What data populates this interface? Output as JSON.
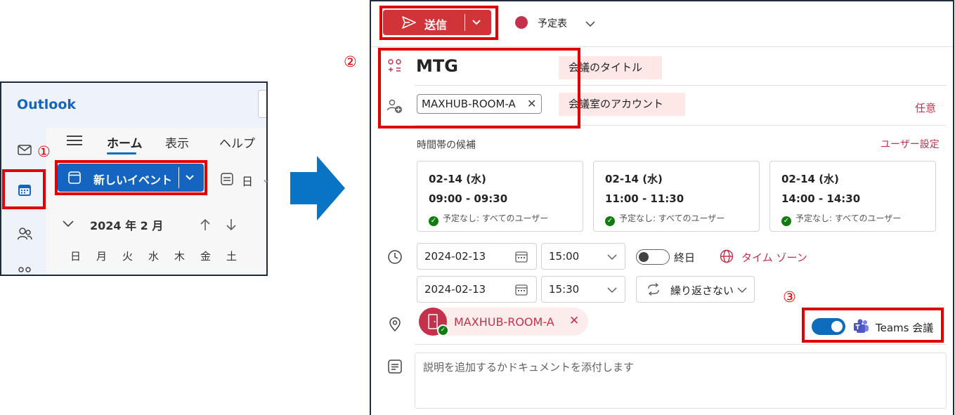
{
  "left": {
    "app_title": "Outlook",
    "tabs": [
      {
        "label": "ホーム"
      },
      {
        "label": "表示"
      },
      {
        "label": "ヘルプ"
      }
    ],
    "new_event_label": "新しいイベント",
    "day_view_label": "日",
    "month_label": "2024 年 2 月",
    "weekdays": [
      "日",
      "月",
      "火",
      "水",
      "木",
      "金",
      "土"
    ],
    "step_marker": "①"
  },
  "right": {
    "send_label": "送信",
    "calendar_label": "予定表",
    "calendar_color": "#c4314b",
    "title_value": "MTG",
    "title_callout": "会議のタイトル",
    "attendee_chip": "MAXHUB-ROOM-A",
    "attendee_callout": "会議室のアカウント",
    "optional_link": "任意",
    "slots_heading": "時間帯の候補",
    "user_settings_link": "ユーザー設定",
    "slots": [
      {
        "date": "02-14 (水)",
        "time": "09:00 - 09:30",
        "status": "予定なし: すべてのユーザー"
      },
      {
        "date": "02-14 (水)",
        "time": "11:00 - 11:30",
        "status": "予定なし: すべてのユーザー"
      },
      {
        "date": "02-14 (水)",
        "time": "14:00 - 14:30",
        "status": "予定なし: すべてのユーザー"
      }
    ],
    "start_date": "2024-02-13",
    "start_time": "15:00",
    "all_day_label": "終日",
    "timezone_label": "タイム ゾーン",
    "end_date": "2024-02-13",
    "end_time": "15:30",
    "repeat_label": "繰り返さない",
    "room_chip": "MAXHUB-ROOM-A",
    "teams_label": "Teams 会議",
    "description_placeholder": "説明を追加するかドキュメントを添付します",
    "step_marker_2": "②",
    "step_marker_3": "③"
  },
  "colors": {
    "brand_blue": "#1565c0",
    "send_red": "#d13438",
    "highlight_red": "#e00000",
    "accent_red": "#c4314b",
    "arrow_blue": "#0a74c4"
  }
}
